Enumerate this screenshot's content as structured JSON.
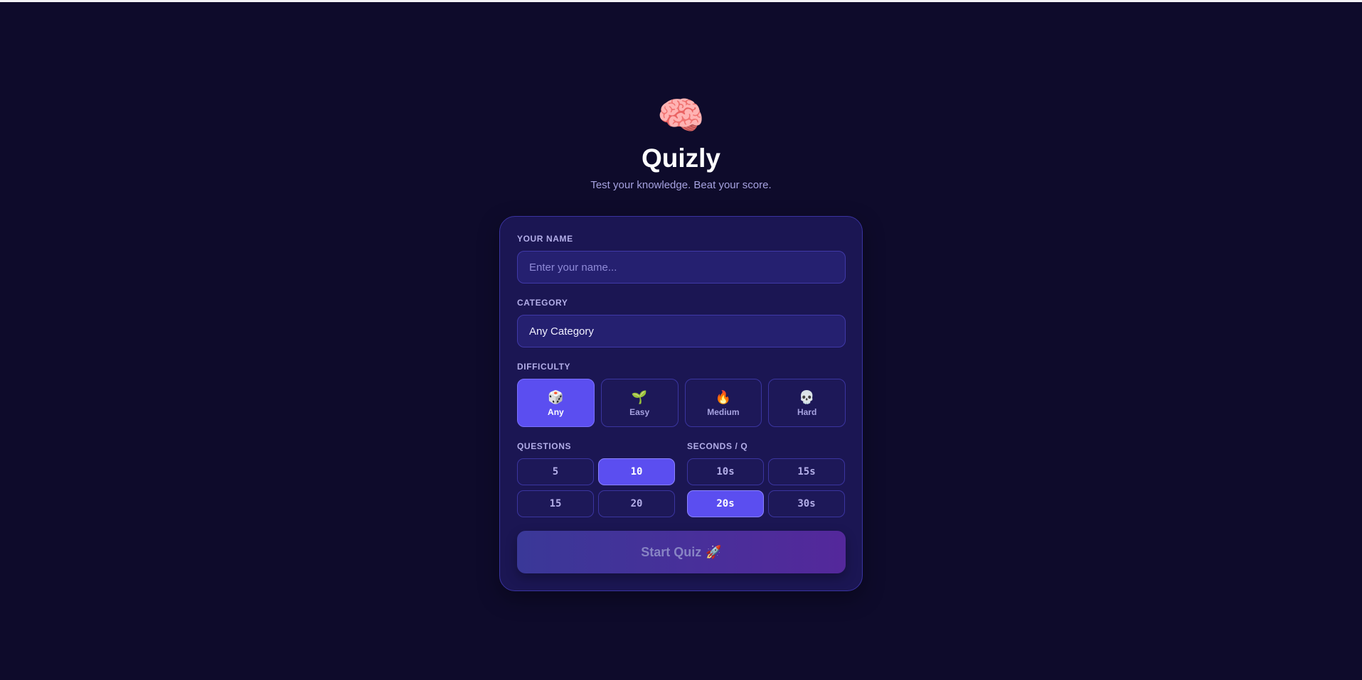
{
  "app": {
    "logo_icon": "🧠",
    "title": "Quizly",
    "subtitle": "Test your knowledge. Beat your score."
  },
  "form": {
    "name_label": "YOUR NAME",
    "name_placeholder": "Enter your name...",
    "name_value": "",
    "category_label": "CATEGORY",
    "category_value": "Any Category",
    "difficulty_label": "DIFFICULTY",
    "difficulties": [
      {
        "icon": "🎲",
        "label": "Any",
        "selected": true
      },
      {
        "icon": "🌱",
        "label": "Easy",
        "selected": false
      },
      {
        "icon": "🔥",
        "label": "Medium",
        "selected": false
      },
      {
        "icon": "💀",
        "label": "Hard",
        "selected": false
      }
    ],
    "questions_label": "QUESTIONS",
    "questions_options": [
      "5",
      "10",
      "15",
      "20"
    ],
    "questions_selected": "10",
    "seconds_label": "SECONDS / Q",
    "seconds_options": [
      "10s",
      "15s",
      "20s",
      "30s"
    ],
    "seconds_selected": "20s",
    "start_label": "Start Quiz",
    "start_icon": "🚀"
  },
  "colors": {
    "background": "#0e0b2b",
    "card": "#1b1653",
    "accent": "#5b4ef0",
    "start_gradient_from": "#3a3898",
    "start_gradient_to": "#54289b"
  }
}
